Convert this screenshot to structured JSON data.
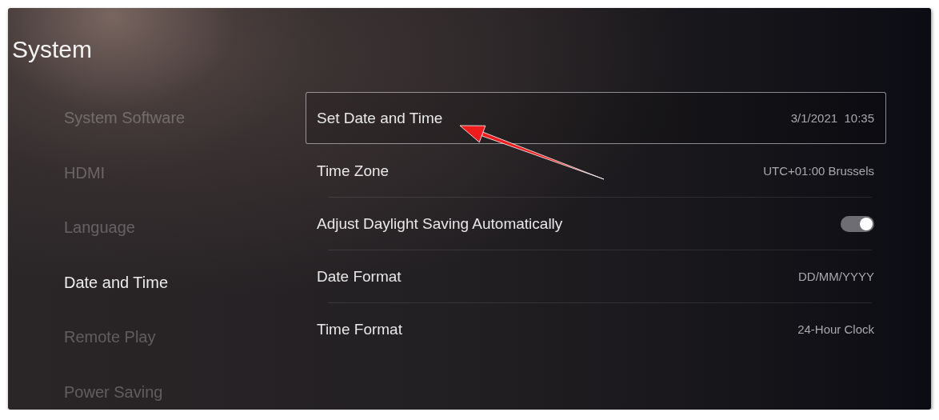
{
  "title": "System",
  "sidebar": {
    "items": [
      {
        "label": "System Software",
        "selected": false
      },
      {
        "label": "HDMI",
        "selected": false
      },
      {
        "label": "Language",
        "selected": false
      },
      {
        "label": "Date and Time",
        "selected": true
      },
      {
        "label": "Remote Play",
        "selected": false
      },
      {
        "label": "Power Saving",
        "selected": false
      }
    ]
  },
  "settings": [
    {
      "kind": "value",
      "label": "Set Date and Time",
      "value": "3/1/2021  10:35",
      "focused": true
    },
    {
      "kind": "value",
      "label": "Time Zone",
      "value": "UTC+01:00 Brussels",
      "focused": false
    },
    {
      "kind": "toggle",
      "label": "Adjust Daylight Saving Automatically",
      "on": true,
      "focused": false
    },
    {
      "kind": "value",
      "label": "Date Format",
      "value": "DD/MM/YYYY",
      "focused": false
    },
    {
      "kind": "value",
      "label": "Time Format",
      "value": "24-Hour Clock",
      "focused": false
    }
  ]
}
